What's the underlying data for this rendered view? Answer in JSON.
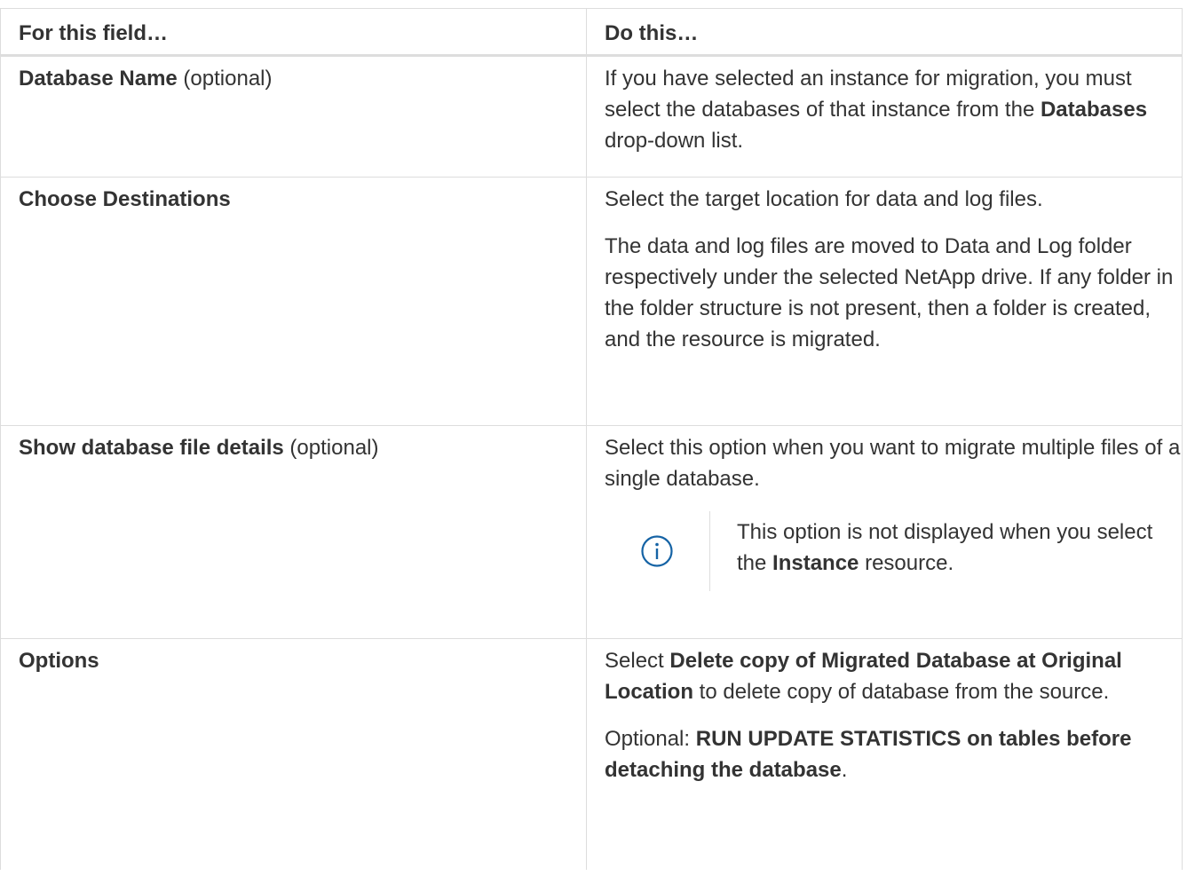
{
  "table": {
    "header": {
      "col1": "For this field…",
      "col2": "Do this…"
    },
    "rows": [
      {
        "field_bold": "Database Name",
        "field_suffix": " (optional)",
        "desc_p1_a": "If you have selected an instance for migration, you must select the databases of that instance from the ",
        "desc_p1_bold": "Databases",
        "desc_p1_b": " drop-down list."
      },
      {
        "field_bold": "Choose Destinations",
        "desc_p1": "Select the target location for data and log files.",
        "desc_p2": "The data and log files are moved to Data and Log folder respectively under the selected NetApp drive. If any folder in the folder structure is not present, then a folder is created, and the resource is migrated."
      },
      {
        "field_bold": "Show database file details",
        "field_suffix": " (optional)",
        "desc_p1": "Select this option when you want to migrate multiple files of a single database.",
        "note": {
          "icon": "info-circle-icon",
          "text_a": "This option is not displayed when you select the ",
          "text_bold": "Instance",
          "text_b": " resource."
        }
      },
      {
        "field_bold": "Options",
        "desc_p1_a": "Select ",
        "desc_p1_bold": "Delete copy of Migrated Database at Original Location",
        "desc_p1_b": " to delete copy of database from the source.",
        "desc_p2_a": "Optional: ",
        "desc_p2_bold": "RUN UPDATE STATISTICS on tables before detaching the database",
        "desc_p2_b": "."
      }
    ]
  },
  "colors": {
    "text": "#333333",
    "border": "#dddddd",
    "icon": "#1563a5"
  }
}
